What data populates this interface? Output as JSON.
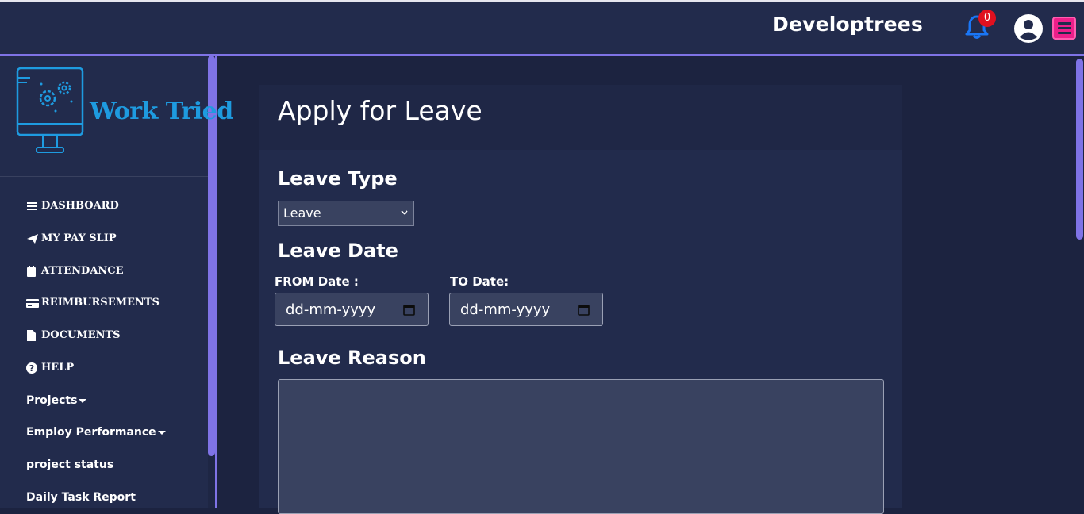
{
  "header": {
    "brand": "Developtrees",
    "notification_count": "0"
  },
  "sidebar": {
    "logo_text": "Work Tried",
    "items": [
      {
        "label": "DASHBOARD",
        "icon": "bars-icon"
      },
      {
        "label": "MY PAY SLIP",
        "icon": "paper-plane-icon"
      },
      {
        "label": "ATTENDANCE",
        "icon": "calendar-icon"
      },
      {
        "label": "REIMBURSEMENTS",
        "icon": "credit-card-icon"
      },
      {
        "label": "DOCUMENTS",
        "icon": "file-icon"
      },
      {
        "label": "HELP",
        "icon": "question-circle-icon"
      },
      {
        "label": "Projects"
      },
      {
        "label": "Employ Performance"
      },
      {
        "label": "project status"
      },
      {
        "label": "Daily Task Report"
      }
    ]
  },
  "form": {
    "title": "Apply for Leave",
    "leave_type_label": "Leave Type",
    "leave_type_value": "Leave",
    "leave_date_label": "Leave Date",
    "from_label": "FROM Date :",
    "to_label": "TO Date:",
    "from_placeholder": "dd-mm-yyyy",
    "to_placeholder": "dd-mm-yyyy",
    "reason_label": "Leave Reason"
  },
  "colors": {
    "accent": "#7f73e6",
    "menu_button": "#ed1f8a",
    "badge": "#e0101f",
    "logo": "#1e9be0"
  }
}
